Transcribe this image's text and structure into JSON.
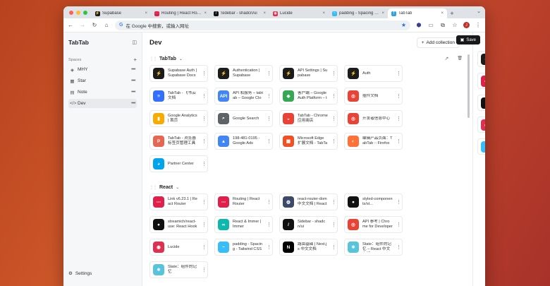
{
  "browser": {
    "tabs": [
      {
        "label": "Supabase",
        "icon": "supabase-icon",
        "color": "#1c1c1c",
        "glyph": "⚡",
        "active": false
      },
      {
        "label": "Routing | React Router",
        "icon": "react-router-icon",
        "color": "#e0204b",
        "glyph": "⋯",
        "active": false
      },
      {
        "label": "Sidebar - shadcn/ui",
        "icon": "shadcn-icon",
        "color": "#111111",
        "glyph": "/",
        "active": false
      },
      {
        "label": "Lucide",
        "icon": "lucide-icon",
        "color": "#e0304f",
        "glyph": "◉",
        "active": false
      },
      {
        "label": "padding - Spacing - Tail",
        "icon": "tailwind-icon",
        "color": "#38bdf8",
        "glyph": "~",
        "active": false
      },
      {
        "label": "TabTab",
        "icon": "tabtab-icon",
        "color": "#2da3e3",
        "glyph": "T",
        "active": true
      }
    ],
    "address": "在 Google 中搜索，或输入网址",
    "profile_initial": "J"
  },
  "sidebar": {
    "title": "TabTab",
    "spaces_label": "Spaces",
    "spaces": [
      {
        "label": "MHY",
        "icon": "cube-icon",
        "glyph": "◈",
        "active": false
      },
      {
        "label": "Star",
        "icon": "grid-icon",
        "glyph": "▦",
        "active": false
      },
      {
        "label": "Note",
        "icon": "note-icon",
        "glyph": "▤",
        "active": false
      },
      {
        "label": "Dev",
        "icon": "code-icon",
        "glyph": "</>",
        "active": true
      }
    ],
    "settings_label": "Settings"
  },
  "main": {
    "title": "Dev",
    "add_collection": "Add collection",
    "collections": [
      {
        "name": "TabTab",
        "cards": [
          {
            "label": "Supabase Auth | Supabase Docs",
            "icon": "supabase-icon",
            "color": "#1c1c1c",
            "glyph": "⚡"
          },
          {
            "label": "Authentication | Supabase",
            "icon": "supabase-icon",
            "color": "#1c1c1c",
            "glyph": "⚡"
          },
          {
            "label": "API Settings | Supabase",
            "icon": "supabase-icon",
            "color": "#1c1c1c",
            "glyph": "⚡"
          },
          {
            "label": "Auth",
            "icon": "supabase-icon",
            "color": "#1c1c1c",
            "glyph": "⚡"
          },
          {
            "label": "TabTab - 飞书云文档",
            "icon": "feishu-doc-icon",
            "color": "#3370ff",
            "glyph": "≡"
          },
          {
            "label": "API 和服务 – tabtab – Google Cloud",
            "icon": "google-cloud-api-icon",
            "color": "#4285f4",
            "glyph": "API"
          },
          {
            "label": "客户端 – Google Auth Platform – tabtab",
            "icon": "google-cloud-icon",
            "color": "#34a853",
            "glyph": "◆"
          },
          {
            "label": "插件文档",
            "icon": "chrome-icon",
            "color": "#ea4335",
            "glyph": "◎"
          },
          {
            "label": "Google Analytics | 首页",
            "icon": "google-analytics-icon",
            "color": "#f9ab00",
            "glyph": "▮"
          },
          {
            "label": "Google Search",
            "icon": "google-search-console-icon",
            "color": "#5f6368",
            "glyph": "⌕"
          },
          {
            "label": "TabTab - Chrome 应用商店",
            "icon": "chrome-webstore-icon",
            "color": "#ea4335",
            "glyph": "◒"
          },
          {
            "label": "开发者信息中心",
            "icon": "chrome-icon",
            "color": "#ea4335",
            "glyph": "◎"
          },
          {
            "label": "TabTab - 浏览器标签页管理工具",
            "icon": "producthunt-icon",
            "color": "#e8654f",
            "glyph": "P"
          },
          {
            "label": "198-481-0195 - Google Ads",
            "icon": "google-ads-icon",
            "color": "#4285f4",
            "glyph": "▲"
          },
          {
            "label": "Microsoft Edge 扩展文档 - TabTab",
            "icon": "edge-addons-icon",
            "color": "#f25022",
            "glyph": "▦"
          },
          {
            "label": "编辑产品页面：TabTab :: Firefox",
            "icon": "firefox-icon",
            "color": "#ff7139",
            "glyph": "◐"
          },
          {
            "label": "Partner Center",
            "icon": "microsoft-icon",
            "color": "#00a4ef",
            "glyph": "◕"
          }
        ]
      },
      {
        "name": "React",
        "cards": [
          {
            "label": "Link v6.23.1 | React Router",
            "icon": "react-router-icon",
            "color": "#e0204b",
            "glyph": "⋯"
          },
          {
            "label": "Routing | React Router",
            "icon": "react-router-icon",
            "color": "#e0204b",
            "glyph": "⋯"
          },
          {
            "label": "react-router-dom 中文文档 | React Router",
            "icon": "react-router-cn-icon",
            "color": "#3b4a6b",
            "glyph": "◍"
          },
          {
            "label": "styled-components/st...",
            "icon": "github-icon",
            "color": "#111111",
            "glyph": "●"
          },
          {
            "label": "streamich/react-use: React Hooks",
            "icon": "github-icon",
            "color": "#111111",
            "glyph": "●"
          },
          {
            "label": "React & Immer | Immer",
            "icon": "immer-icon",
            "color": "#0fb7ac",
            "glyph": "∞"
          },
          {
            "label": "Sidebar - shadcn/ui",
            "icon": "shadcn-icon",
            "color": "#111111",
            "glyph": "/"
          },
          {
            "label": "API 参考 | Chrome for Developers",
            "icon": "chrome-icon",
            "color": "#ea4335",
            "glyph": "◎"
          },
          {
            "label": "Lucide",
            "icon": "lucide-icon",
            "color": "#e0304f",
            "glyph": "◉"
          },
          {
            "label": "padding - Spacing - Tailwind CSS",
            "icon": "tailwind-icon",
            "color": "#38bdf8",
            "glyph": "~"
          },
          {
            "label": "路由基础 | Next.js 中文文档",
            "icon": "nextjs-icon",
            "color": "#000000",
            "glyph": "N"
          },
          {
            "label": "State：组件的记忆 – React 中文文档",
            "icon": "react-icon",
            "color": "#58c4dc",
            "glyph": "⚛"
          },
          {
            "label": "State：组件的记忆",
            "icon": "react-icon",
            "color": "#58c4dc",
            "glyph": "⚛"
          }
        ]
      }
    ]
  },
  "right_panel": {
    "save_label": "Save",
    "items": [
      {
        "label": "Supabase",
        "icon": "supabase-icon",
        "color": "#1c1c1c",
        "glyph": "⚡"
      },
      {
        "label": "Routing | React Router",
        "icon": "react-router-icon",
        "color": "#e0204b",
        "glyph": "⋯"
      },
      {
        "label": "Sidebar - shadcn/ui",
        "icon": "shadcn-icon",
        "color": "#111111",
        "glyph": "/"
      },
      {
        "label": "Lucide",
        "icon": "lucide-icon",
        "color": "#e0304f",
        "glyph": "◉"
      },
      {
        "label": "padding - Spacing - Tailwind CSS",
        "icon": "tailwind-icon",
        "color": "#38bdf8",
        "glyph": "~"
      }
    ]
  }
}
